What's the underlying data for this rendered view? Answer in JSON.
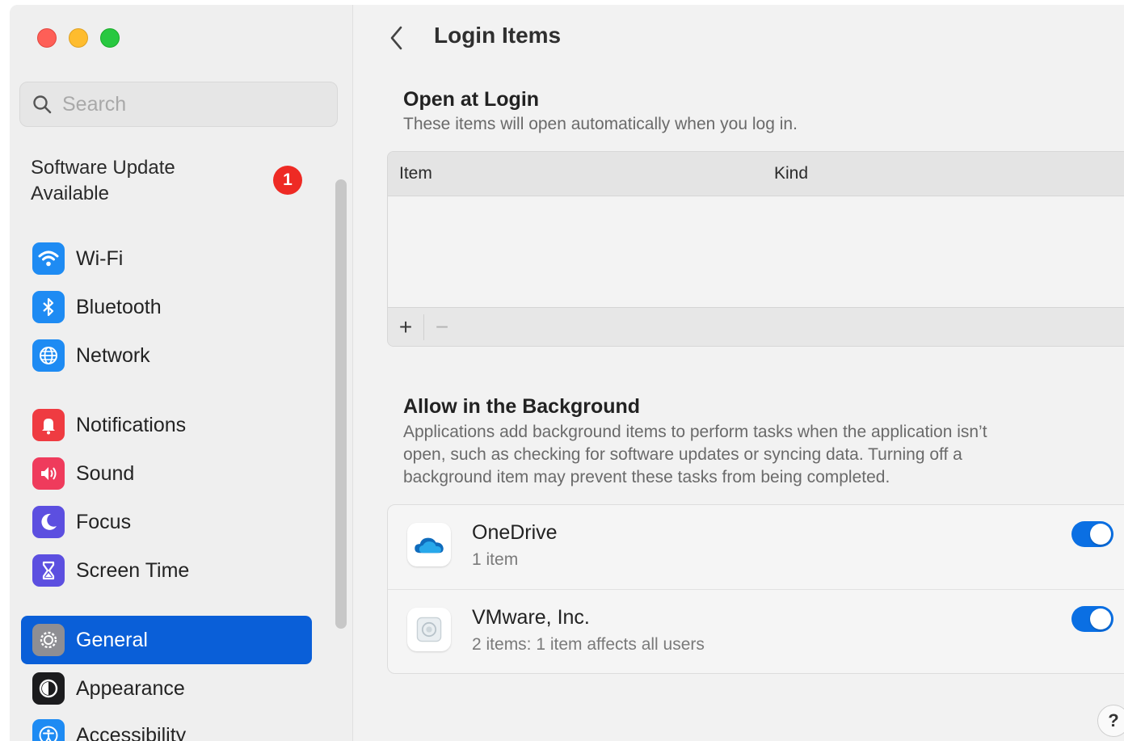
{
  "window": {
    "traffic_lights": {
      "close": "#fe5f57",
      "minimize": "#febc2e",
      "zoom": "#28c840"
    }
  },
  "sidebar": {
    "search": {
      "placeholder": "Search",
      "icon": "magnifying-glass-icon"
    },
    "update": {
      "label": "Software Update Available",
      "badge": "1",
      "badge_color": "#ee2a24"
    },
    "items": [
      {
        "label": "Wi-Fi",
        "icon": "wifi-icon",
        "color": "#1e8bf3"
      },
      {
        "label": "Bluetooth",
        "icon": "bluetooth-icon",
        "color": "#1e8bf3"
      },
      {
        "label": "Network",
        "icon": "globe-icon",
        "color": "#1e8bf3"
      },
      {
        "label": "Notifications",
        "icon": "bell-icon",
        "color": "#ef3b41"
      },
      {
        "label": "Sound",
        "icon": "speaker-icon",
        "color": "#ef3b5c"
      },
      {
        "label": "Focus",
        "icon": "moon-icon",
        "color": "#5c4fe0"
      },
      {
        "label": "Screen Time",
        "icon": "hourglass-icon",
        "color": "#5c4fe0"
      },
      {
        "label": "General",
        "icon": "gear-icon",
        "color": "#8e8e93",
        "selected": true
      },
      {
        "label": "Appearance",
        "icon": "appearance-icon",
        "color": "#1c1c1e"
      },
      {
        "label": "Accessibility",
        "icon": "accessibility-icon",
        "color": "#1e8bf3"
      }
    ],
    "selection_color": "#0a5fd8"
  },
  "main": {
    "title": "Login Items",
    "open_at_login": {
      "title": "Open at Login",
      "subtitle": "These items will open automatically when you log in.",
      "columns": [
        "Item",
        "Kind"
      ],
      "rows": [],
      "add_label": "+",
      "remove_label": "−"
    },
    "background": {
      "title": "Allow in the Background",
      "description_lines": [
        "Applications add background items to perform tasks when the application isn’t",
        "open, such as checking for software updates or syncing data. Turning off a",
        "background item may prevent these tasks from being completed."
      ],
      "items": [
        {
          "name": "OneDrive",
          "detail": "1 item",
          "enabled": true,
          "icon": "onedrive-cloud-icon"
        },
        {
          "name": "VMware, Inc.",
          "detail": "2 items: 1 item affects all users",
          "enabled": true,
          "icon": "vmware-icon"
        }
      ],
      "toggle_color": "#0a6fe3"
    },
    "help_label": "?"
  }
}
